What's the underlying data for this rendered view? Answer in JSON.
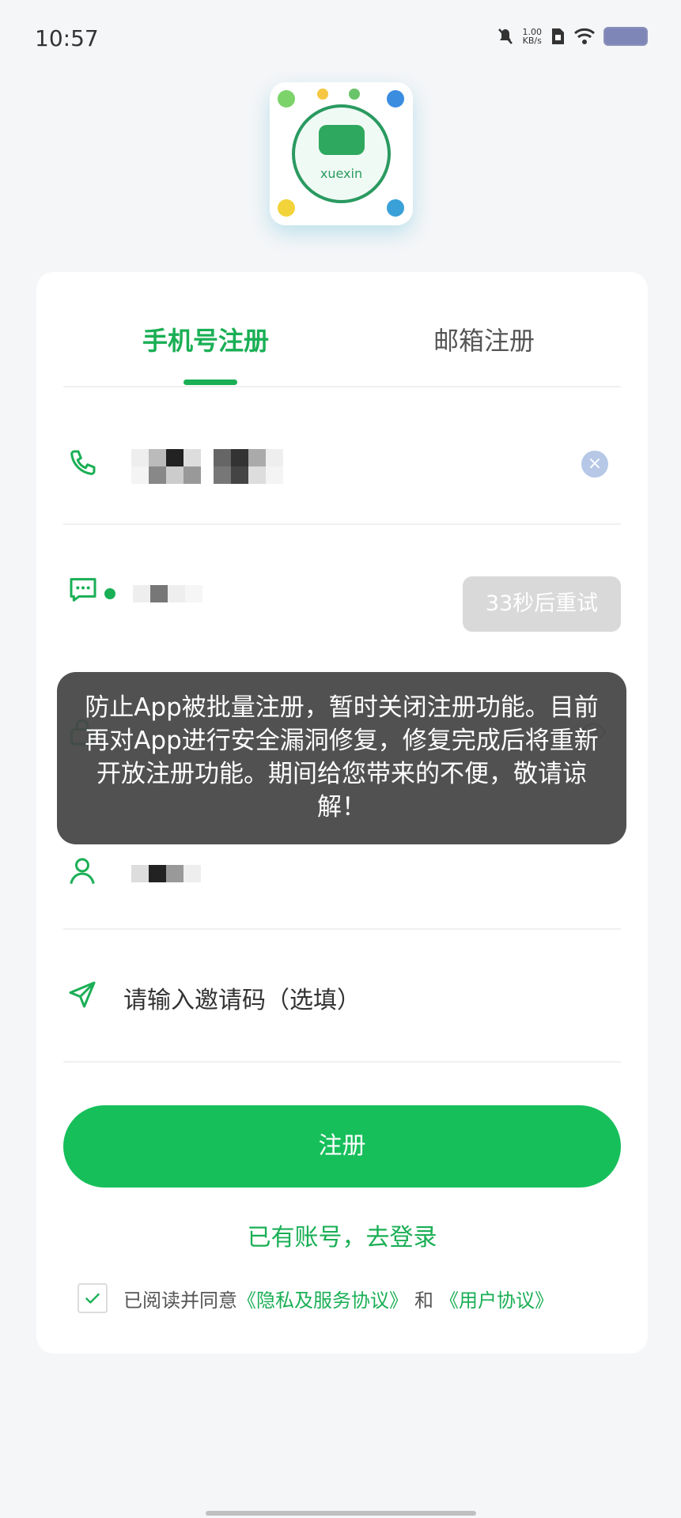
{
  "status_bar": {
    "time": "10:57",
    "net_speed_value": "1.00",
    "net_speed_unit": "KB/s"
  },
  "logo": {
    "brand": "xuexin"
  },
  "tabs": {
    "phone": "手机号注册",
    "email": "邮箱注册"
  },
  "fields": {
    "code_button": "33秒后重试",
    "invite_placeholder": "请输入邀请码（选填）"
  },
  "actions": {
    "register": "注册",
    "login_link": "已有账号，去登录"
  },
  "agreement": {
    "prefix": "已阅读并同意",
    "privacy": "《隐私及服务协议》",
    "and": "和",
    "user": "《用户协议》"
  },
  "toast": {
    "message": "防止App被批量注册，暂时关闭注册功能。目前再对App进行安全漏洞修复，修复完成后将重新开放注册功能。期间给您带来的不便，敬请谅解！"
  },
  "colors": {
    "accent": "#17bf5b",
    "toast_bg": "#464646"
  },
  "icons": {
    "phone": "phone-icon",
    "message": "message-icon",
    "lock": "lock-icon",
    "user": "user-icon",
    "send": "send-icon",
    "clear": "clear-icon",
    "check": "check-icon"
  }
}
